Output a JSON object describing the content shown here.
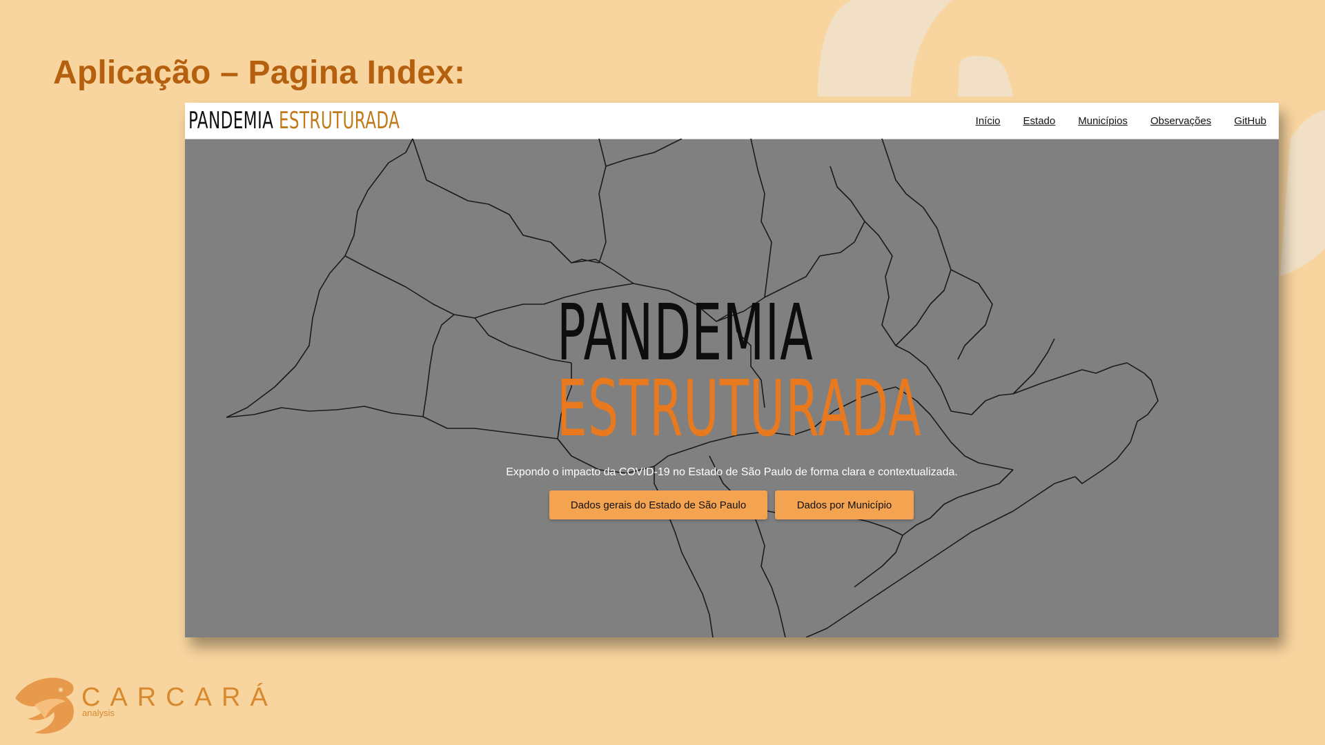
{
  "slide": {
    "title": "Aplicação – Pagina Index:"
  },
  "browser": {
    "brand": {
      "word1": "PANDEMIA",
      "word2": "ESTRUTURADA"
    },
    "nav": {
      "items": [
        "Início",
        "Estado",
        "Municípios",
        "Observações",
        "GitHub"
      ]
    },
    "hero": {
      "title_line1": "PANDEMIA",
      "title_line2": "ESTRUTURADA",
      "tagline": "Expondo o impacto da COVID-19 no Estado de São Paulo de forma clara e contextualizada.",
      "buttons": [
        "Dados gerais do Estado de São Paulo",
        "Dados por Município"
      ]
    }
  },
  "logo": {
    "name": "CARCARÁ",
    "sub": "analysis"
  },
  "colors": {
    "slide_bg": "#f8d49e",
    "title": "#b5600e",
    "hero_bg": "#808080",
    "accent": "#e8791f",
    "button": "#f4a350"
  },
  "icons": {
    "logo": "carcara-bird-icon",
    "map": "sao-paulo-regions-map"
  }
}
